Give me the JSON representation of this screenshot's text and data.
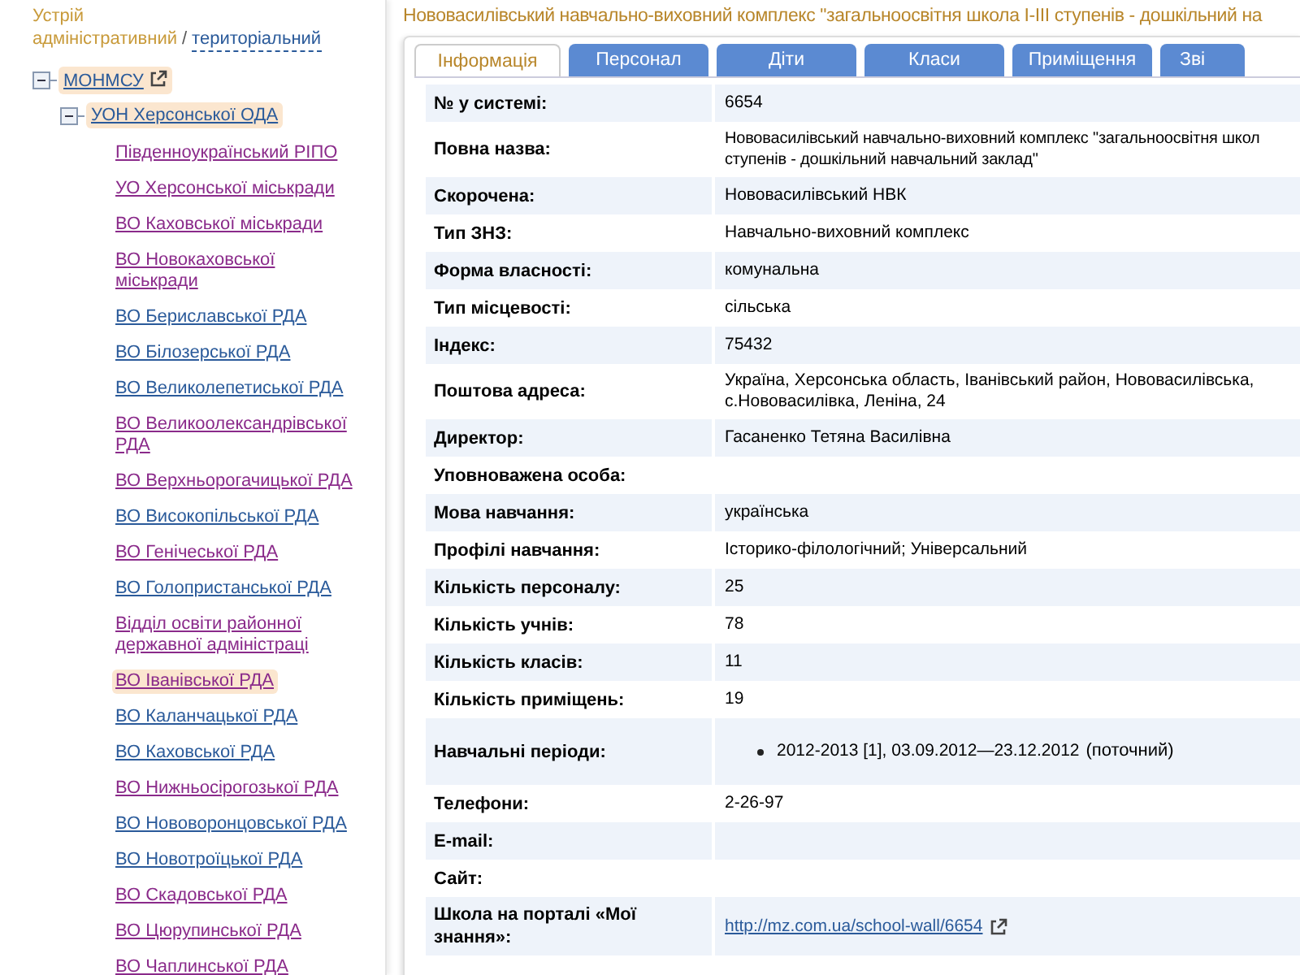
{
  "structure_switch": {
    "heading": "Устрій",
    "separator": "/",
    "options": [
      {
        "label": "адміністративний",
        "selected": true
      },
      {
        "label": "територіальний",
        "selected": false
      }
    ]
  },
  "tree": [
    {
      "label": "МОНМСУ",
      "expanded": true,
      "selected": true,
      "external": true,
      "visited": false,
      "children": [
        {
          "label": "УОН Херсонської ОДА",
          "expanded": true,
          "selected": true,
          "visited": false,
          "children": [
            {
              "label": "Південноукраїнський РІПО",
              "selected": false,
              "visited": true
            },
            {
              "label": "УО Херсонської міськради",
              "selected": false,
              "visited": true
            },
            {
              "label": "ВО Каховської міськради",
              "selected": false,
              "visited": true
            },
            {
              "label": "ВО Новокаховської міськради",
              "selected": false,
              "visited": true
            },
            {
              "label": "ВО Бериславської РДА",
              "selected": false,
              "visited": false
            },
            {
              "label": "ВО Білозерської РДА",
              "selected": false,
              "visited": false
            },
            {
              "label": "ВО Великолепетиської РДА",
              "selected": false,
              "visited": false
            },
            {
              "label": "ВО Великоолександрівської РДА",
              "selected": false,
              "visited": true
            },
            {
              "label": "ВО Верхньорогачицької РДА",
              "selected": false,
              "visited": true
            },
            {
              "label": "ВО Високопільської РДА",
              "selected": false,
              "visited": false
            },
            {
              "label": "ВО Генічеської РДА",
              "selected": false,
              "visited": true
            },
            {
              "label": "ВО Голопристанської РДА",
              "selected": false,
              "visited": false
            },
            {
              "label": "Відділ освіти районної державної адміністраці",
              "selected": false,
              "visited": true
            },
            {
              "label": "ВО Іванівської РДА",
              "selected": true,
              "visited": true
            },
            {
              "label": "ВО Каланчацької РДА",
              "selected": false,
              "visited": false
            },
            {
              "label": "ВО Каховської РДА",
              "selected": false,
              "visited": false
            },
            {
              "label": "ВО Нижньосірогозької РДА",
              "selected": false,
              "visited": true
            },
            {
              "label": "ВО Нововоронцовської РДА",
              "selected": false,
              "visited": false
            },
            {
              "label": "ВО Новотроїцької РДА",
              "selected": false,
              "visited": false
            },
            {
              "label": "ВО Скадовської РДА",
              "selected": false,
              "visited": true
            },
            {
              "label": "ВО Цюрупинської РДА",
              "selected": false,
              "visited": true
            },
            {
              "label": "ВО Чаплинської РДА",
              "selected": false,
              "visited": true
            }
          ]
        }
      ]
    }
  ],
  "page_title": "Нововасилівський навчально-виховний комплекс \"загальноосвітня школа I-III ступенів - дошкільний на",
  "tabs": [
    {
      "label": "Інформація",
      "selected": true
    },
    {
      "label": "Персонал",
      "selected": false
    },
    {
      "label": "Діти",
      "selected": false
    },
    {
      "label": "Класи",
      "selected": false
    },
    {
      "label": "Приміщення",
      "selected": false
    },
    {
      "label": "Зві",
      "selected": false
    }
  ],
  "info_rows": [
    {
      "kind": "text",
      "label": "№ у системі:",
      "value": "6654"
    },
    {
      "kind": "lines",
      "label": "Повна назва:",
      "lines": [
        "Нововасилівський навчально-виховний комплекс \"загальноосвітня школ",
        "ступенів - дошкільний навчальний заклад\""
      ]
    },
    {
      "kind": "text",
      "label": "Скорочена:",
      "value": "Нововасилівський НВК"
    },
    {
      "kind": "text",
      "label": "Тип ЗНЗ:",
      "value": "Навчально-виховний комплекс"
    },
    {
      "kind": "text",
      "label": "Форма власності:",
      "value": "комунальна"
    },
    {
      "kind": "text",
      "label": "Тип місцевості:",
      "value": "сільська"
    },
    {
      "kind": "text",
      "label": "Індекс:",
      "value": "75432"
    },
    {
      "kind": "text",
      "label": "Поштова адреса:",
      "value": "Україна, Херсонська область, Іванівський район, Нововасилівська, с.Нововасилівка, Леніна, 24"
    },
    {
      "kind": "text",
      "label": "Директор:",
      "value": "Гасаненко Тетяна Василівна"
    },
    {
      "kind": "empty",
      "label": "Уповноважена особа:"
    },
    {
      "kind": "text",
      "label": "Мова навчання:",
      "value": "українська"
    },
    {
      "kind": "text",
      "label": "Профілі навчання:",
      "value": "Історико-філологічний; Універсальний"
    },
    {
      "kind": "text",
      "label": "Кількість персоналу:",
      "value": "25"
    },
    {
      "kind": "text",
      "label": "Кількість учнів:",
      "value": "78"
    },
    {
      "kind": "text",
      "label": "Кількість класів:",
      "value": "11"
    },
    {
      "kind": "text",
      "label": "Кількість приміщень:",
      "value": "19"
    },
    {
      "kind": "list",
      "label": "Навчальні періоди:",
      "items": [
        {
          "period": "2012-2013 [1], 03.09.2012—23.12.2012",
          "note": "(поточний)"
        }
      ]
    },
    {
      "kind": "text",
      "label": "Телефони:",
      "value": "2-26-97"
    },
    {
      "kind": "empty",
      "label": "E-mail:"
    },
    {
      "kind": "empty",
      "label": "Сайт:"
    },
    {
      "kind": "link",
      "label": "Школа на порталі «Мої знання»:",
      "value": "http://mz.com.ua/school-wall/6654"
    }
  ]
}
